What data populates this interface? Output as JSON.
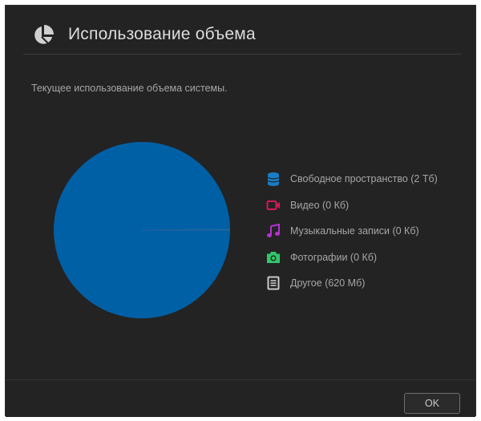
{
  "dialog": {
    "title": "Использование объема",
    "icon": "pie-chart-icon",
    "description": "Текущее использование объема системы.",
    "ok_label": "OK"
  },
  "legend": [
    {
      "name": "free-space",
      "label": "Свободное пространство (2 Тб)",
      "icon": "database-icon",
      "color": "#1a7dc4"
    },
    {
      "name": "video",
      "label": "Видео (0 Кб)",
      "icon": "video-camera-icon",
      "color": "#d41a5c"
    },
    {
      "name": "music",
      "label": "Музыкальные записи (0 Кб)",
      "icon": "music-note-icon",
      "color": "#b62fd4"
    },
    {
      "name": "photos",
      "label": "Фотографии (0 Кб)",
      "icon": "camera-icon",
      "color": "#2fc86a"
    },
    {
      "name": "other",
      "label": "Другое (620 Мб)",
      "icon": "document-icon",
      "color": "#c8c8c8"
    }
  ],
  "chart_data": {
    "type": "pie",
    "slices": [
      {
        "label": "Свободное пространство",
        "value": 2000000,
        "color": "#0060a6"
      },
      {
        "label": "Видео",
        "value": 0,
        "color": "#d41a5c"
      },
      {
        "label": "Музыкальные записи",
        "value": 0,
        "color": "#b62fd4"
      },
      {
        "label": "Фотографии",
        "value": 0,
        "color": "#2fc86a"
      },
      {
        "label": "Другое",
        "value": 620,
        "color": "#9a9a9a"
      }
    ],
    "unit": "MB"
  }
}
